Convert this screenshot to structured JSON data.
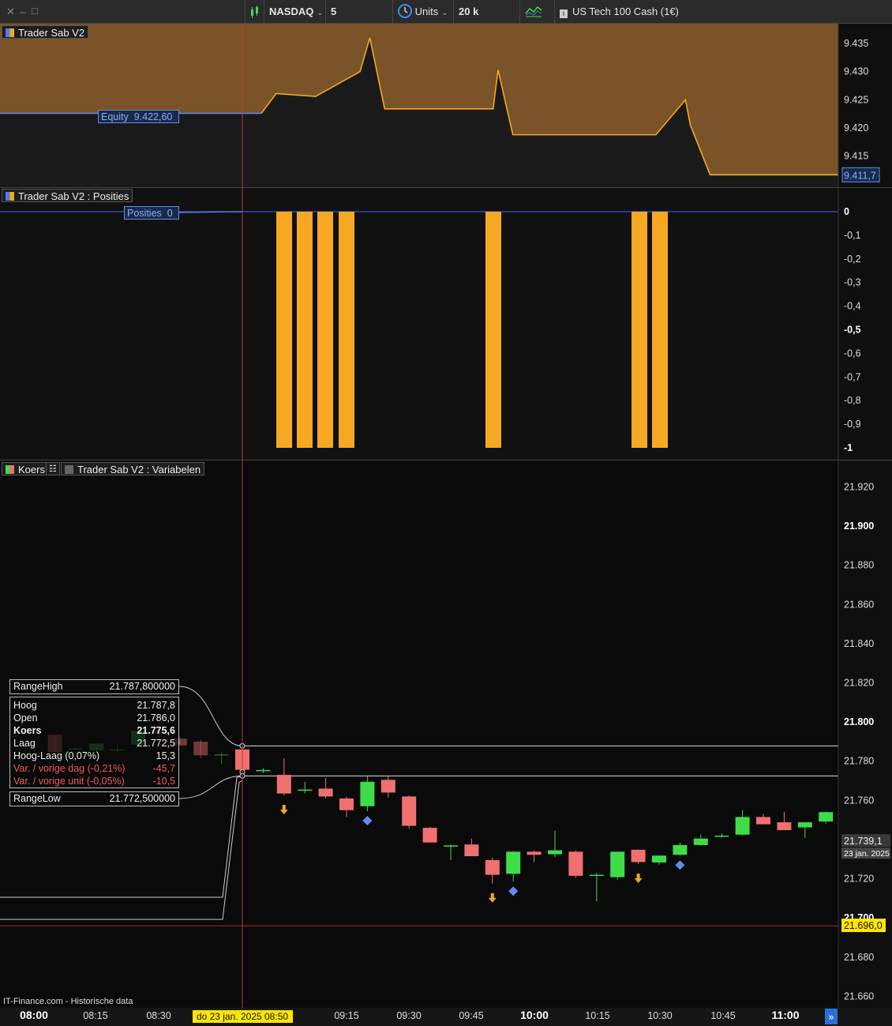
{
  "toolbar": {
    "window_buttons": [
      "✕",
      "_",
      "□"
    ],
    "market": "NASDAQ",
    "timeframe": "5 minuten",
    "units_label": "Units",
    "units_value": "20 k units",
    "instrument": "US Tech 100 Cash (1€)"
  },
  "panels": {
    "equity_title": "Trader Sab V2",
    "positions_title": "Trader Sab V2 : Posities",
    "price_title": "Koers",
    "variables_title": "Trader Sab V2 : Variabelen"
  },
  "tags": {
    "equity_label": "Equity",
    "equity_value": "9.422,60",
    "positions_label": "Posities",
    "positions_value": "0"
  },
  "infobox": {
    "range_high_label": "RangeHigh",
    "range_high_value": "21.787,800000",
    "range_low_label": "RangeLow",
    "range_low_value": "21.772,500000",
    "rows": [
      {
        "label": "Hoog",
        "value": "21.787,8",
        "style": ""
      },
      {
        "label": "Open",
        "value": "21.786,0",
        "style": ""
      },
      {
        "label": "Koers",
        "value": "21.775,6",
        "style": "bold"
      },
      {
        "label": "Laag",
        "value": "21.772,5",
        "style": ""
      },
      {
        "label": "Hoog-Laag (0,07%)",
        "value": "15,3",
        "style": ""
      },
      {
        "label": "Var. / vorige dag (-0,21%)",
        "value": "-45,7",
        "style": "red"
      },
      {
        "label": "Var. / vorige unit (-0,05%)",
        "value": "-10,5",
        "style": "red"
      }
    ]
  },
  "source": "IT-Finance.com - Historische data",
  "colors": {
    "equity_fill": "#7a5428",
    "equity_line": "#f5a623",
    "equity_line_flat": "#5c8ef0",
    "position_bar": "#f7a823",
    "candle_up": "#3fdc4a",
    "candle_down": "#f07070",
    "crosshair": "#c83232",
    "date_highlight": "#ffe600"
  },
  "chart_data": [
    {
      "type": "area",
      "panel": "equity",
      "title": "Trader Sab V2",
      "yticks": [
        "9.435",
        "9.430",
        "9.425",
        "9.420",
        "9.415"
      ],
      "ylim": [
        9.4095,
        9.4385
      ],
      "last_value_label": "9.411,7",
      "x": [
        0,
        43,
        47,
        53,
        56,
        64,
        64,
        73,
        75,
        78,
        94,
        100,
        101,
        104,
        107,
        110,
        133,
        139,
        140,
        144,
        170
      ],
      "y": [
        9.4226,
        9.4226,
        9.4226,
        9.4226,
        9.4261,
        9.4256,
        9.4256,
        9.43,
        9.436,
        9.4234,
        9.4234,
        9.4234,
        9.4303,
        9.4188,
        9.4188,
        9.4188,
        9.4188,
        9.425,
        9.4205,
        9.4117,
        9.4117
      ]
    },
    {
      "type": "bar",
      "panel": "positions",
      "title": "Trader Sab V2 : Posities",
      "yticks": [
        "0",
        "-0,1",
        "-0,2",
        "-0,3",
        "-0,4",
        "-0,5",
        "-0,6",
        "-0,7",
        "-0,8",
        "-0,9",
        "-1"
      ],
      "ylim": [
        -1.03,
        0.03
      ],
      "bars": [
        {
          "x": 55,
          "value": -1
        },
        {
          "x": 58,
          "value": -1
        },
        {
          "x": 62,
          "value": -1
        },
        {
          "x": 65,
          "value": -1
        },
        {
          "x": 95,
          "value": -1
        },
        {
          "x": 124,
          "value": -1
        },
        {
          "x": 128,
          "value": -1
        }
      ]
    },
    {
      "type": "candlestick",
      "panel": "price",
      "title": "Koers",
      "yticks": [
        "21.920",
        "21.900",
        "21.880",
        "21.860",
        "21.840",
        "21.820",
        "21.800",
        "21.780",
        "21.760",
        "21.740",
        "21.720",
        "21.700",
        "21.680",
        "21.660"
      ],
      "ylim": [
        21.6545,
        21.9335
      ],
      "price_marker": "21.739,1",
      "date_marker": "23 jan. 2025",
      "low_marker": "21.696,0",
      "range_high": 21.7878,
      "range_low": 21.7725,
      "xticks": [
        "08:00",
        "08:15",
        "08:30",
        "09:15",
        "09:30",
        "09:45",
        "10:00",
        "10:15",
        "10:30",
        "10:45",
        "11:00"
      ],
      "xtick_index": [
        0,
        3,
        6,
        15,
        18,
        21,
        24,
        27,
        30,
        33,
        36
      ],
      "x_cursor_label": "do 23 jan. 2025 08:50",
      "candles": [
        {
          "i": 1,
          "o": 21.7935,
          "h": 21.7935,
          "l": 21.7835,
          "c": 21.7845
        },
        {
          "i": 2,
          "o": 21.7865,
          "h": 21.7872,
          "l": 21.7858,
          "c": 21.7865
        },
        {
          "i": 3,
          "o": 21.7855,
          "h": 21.787,
          "l": 21.7848,
          "c": 21.789
        },
        {
          "i": 4,
          "o": 21.7855,
          "h": 21.7885,
          "l": 21.7845,
          "c": 21.786
        },
        {
          "i": 5,
          "o": 21.7885,
          "h": 21.7995,
          "l": 21.788,
          "c": 21.7955
        },
        {
          "i": 6,
          "o": 21.795,
          "h": 21.7995,
          "l": 21.792,
          "c": 21.7945
        },
        {
          "i": 7,
          "o": 21.7915,
          "h": 21.7925,
          "l": 21.7885,
          "c": 21.788
        },
        {
          "i": 8,
          "o": 21.79,
          "h": 21.791,
          "l": 21.7815,
          "c": 21.783
        },
        {
          "i": 9,
          "o": 21.7835,
          "h": 21.7845,
          "l": 21.7785,
          "c": 21.7835
        },
        {
          "i": 10,
          "o": 21.786,
          "h": 21.7878,
          "l": 21.7725,
          "c": 21.7756
        },
        {
          "i": 11,
          "o": 21.775,
          "h": 21.7765,
          "l": 21.774,
          "c": 21.7755
        },
        {
          "i": 12,
          "o": 21.773,
          "h": 21.7815,
          "l": 21.7625,
          "c": 21.7635
        },
        {
          "i": 13,
          "o": 21.765,
          "h": 21.7695,
          "l": 21.7635,
          "c": 21.7655
        },
        {
          "i": 14,
          "o": 21.766,
          "h": 21.7715,
          "l": 21.761,
          "c": 21.762
        },
        {
          "i": 15,
          "o": 21.761,
          "h": 21.762,
          "l": 21.7515,
          "c": 21.755
        },
        {
          "i": 16,
          "o": 21.757,
          "h": 21.7725,
          "l": 21.7545,
          "c": 21.7695
        },
        {
          "i": 17,
          "o": 21.7705,
          "h": 21.7725,
          "l": 21.7615,
          "c": 21.764
        },
        {
          "i": 18,
          "o": 21.762,
          "h": 21.7625,
          "l": 21.7455,
          "c": 21.747
        },
        {
          "i": 19,
          "o": 21.746,
          "h": 21.7465,
          "l": 21.7385,
          "c": 21.7385
        },
        {
          "i": 20,
          "o": 21.737,
          "h": 21.7375,
          "l": 21.7295,
          "c": 21.737
        },
        {
          "i": 21,
          "o": 21.7375,
          "h": 21.7405,
          "l": 21.7315,
          "c": 21.7315
        },
        {
          "i": 22,
          "o": 21.7295,
          "h": 21.7308,
          "l": 21.7175,
          "c": 21.722
        },
        {
          "i": 23,
          "o": 21.7225,
          "h": 21.7342,
          "l": 21.7185,
          "c": 21.7338
        },
        {
          "i": 24,
          "o": 21.7338,
          "h": 21.7345,
          "l": 21.7285,
          "c": 21.7322
        },
        {
          "i": 25,
          "o": 21.7325,
          "h": 21.7445,
          "l": 21.731,
          "c": 21.7345
        },
        {
          "i": 26,
          "o": 21.7338,
          "h": 21.7345,
          "l": 21.7205,
          "c": 21.7215
        },
        {
          "i": 27,
          "o": 21.7215,
          "h": 21.723,
          "l": 21.7085,
          "c": 21.722
        },
        {
          "i": 28,
          "o": 21.7208,
          "h": 21.7335,
          "l": 21.7195,
          "c": 21.7338
        },
        {
          "i": 29,
          "o": 21.7348,
          "h": 21.735,
          "l": 21.7275,
          "c": 21.7285
        },
        {
          "i": 30,
          "o": 21.7283,
          "h": 21.7305,
          "l": 21.7272,
          "c": 21.7318
        },
        {
          "i": 31,
          "o": 21.7322,
          "h": 21.7385,
          "l": 21.7318,
          "c": 21.7372
        },
        {
          "i": 32,
          "o": 21.7372,
          "h": 21.7425,
          "l": 21.7368,
          "c": 21.7405
        },
        {
          "i": 33,
          "o": 21.7418,
          "h": 21.7432,
          "l": 21.741,
          "c": 21.742
        },
        {
          "i": 34,
          "o": 21.7425,
          "h": 21.755,
          "l": 21.742,
          "c": 21.7515
        },
        {
          "i": 35,
          "o": 21.7515,
          "h": 21.7532,
          "l": 21.7478,
          "c": 21.7478
        },
        {
          "i": 36,
          "o": 21.7488,
          "h": 21.7542,
          "l": 21.7448,
          "c": 21.7448
        },
        {
          "i": 37,
          "o": 21.7462,
          "h": 21.7488,
          "l": 21.7408,
          "c": 21.7488
        },
        {
          "i": 38,
          "o": 21.7492,
          "h": 21.7542,
          "l": 21.7482,
          "c": 21.754
        }
      ],
      "sell_arrows": [
        12,
        22,
        29
      ],
      "buy_diamonds": [
        16,
        23,
        31
      ]
    }
  ]
}
